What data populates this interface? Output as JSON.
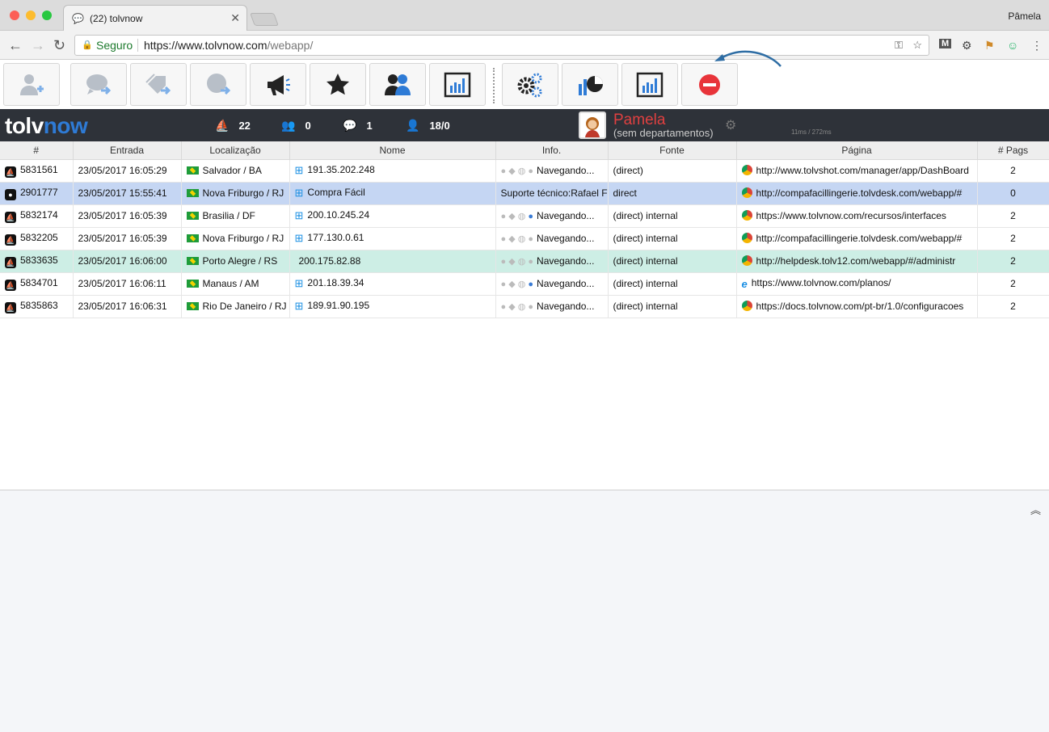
{
  "browser": {
    "tab_title": "(22) tolvnow",
    "user_name": "Pâmela",
    "secure_label": "Seguro",
    "url_main": "https://www.tolvnow.com",
    "url_path": "/webapp/"
  },
  "header": {
    "logo_a": "tolv",
    "logo_b": "now",
    "stats": {
      "visitors": "22",
      "groups": "0",
      "chats": "1",
      "users": "18/0"
    },
    "agent_name": "Pamela",
    "agent_dept": "(sem departamentos)",
    "ping": "11ms / 272ms"
  },
  "table": {
    "columns": [
      "#",
      "Entrada",
      "Localização",
      "Nome",
      "Info.",
      "Fonte",
      "Página",
      "# Pags"
    ],
    "rows": [
      {
        "id": "5831561",
        "entrada": "23/05/2017 16:05:29",
        "local": "Salvador / BA",
        "os": "windows",
        "nome": "191.35.202.248",
        "info": "Navegando...",
        "fonte": "(direct)",
        "browser": "chrome",
        "pagina": "http://www.tolvshot.com/manager/app/DashBoard",
        "pags": "2"
      },
      {
        "id": "2901777",
        "entrada": "23/05/2017 15:55:41",
        "local": "Nova Friburgo / RJ",
        "os": "windows",
        "nome": "Compra Fácil",
        "info": "Suporte técnico:Rafael F",
        "fonte": "direct",
        "browser": "chrome",
        "pagina": "http://compafacillingerie.tolvdesk.com/webapp/#",
        "pags": "0"
      },
      {
        "id": "5832174",
        "entrada": "23/05/2017 16:05:39",
        "local": "Brasilia / DF",
        "os": "windows",
        "nome": "200.10.245.24",
        "info": "Navegando...",
        "fonte": "(direct) internal",
        "browser": "chrome",
        "pagina": "https://www.tolvnow.com/recursos/interfaces",
        "pags": "2"
      },
      {
        "id": "5832205",
        "entrada": "23/05/2017 16:05:39",
        "local": "Nova Friburgo / RJ",
        "os": "windows",
        "nome": "177.130.0.61",
        "info": "Navegando...",
        "fonte": "(direct) internal",
        "browser": "chrome",
        "pagina": "http://compafacillingerie.tolvdesk.com/webapp/#",
        "pags": "2"
      },
      {
        "id": "5833635",
        "entrada": "23/05/2017 16:06:00",
        "local": "Porto Alegre / RS",
        "os": "mac",
        "nome": "200.175.82.88",
        "info": "Navegando...",
        "fonte": "(direct) internal",
        "browser": "chrome",
        "pagina": "http://helpdesk.tolv12.com/webapp/#/administr",
        "pags": "2"
      },
      {
        "id": "5834701",
        "entrada": "23/05/2017 16:06:11",
        "local": "Manaus / AM",
        "os": "windows",
        "nome": "201.18.39.34",
        "info": "Navegando...",
        "fonte": "(direct) internal",
        "browser": "ie",
        "pagina": "https://www.tolvnow.com/planos/",
        "pags": "2"
      },
      {
        "id": "5835863",
        "entrada": "23/05/2017 16:06:31",
        "local": "Rio De Janeiro / RJ",
        "os": "windows",
        "nome": "189.91.90.195",
        "info": "Navegando...",
        "fonte": "(direct) internal",
        "browser": "chrome",
        "pagina": "https://docs.tolvnow.com/pt-br/1.0/configuracoes",
        "pags": "2"
      }
    ]
  }
}
